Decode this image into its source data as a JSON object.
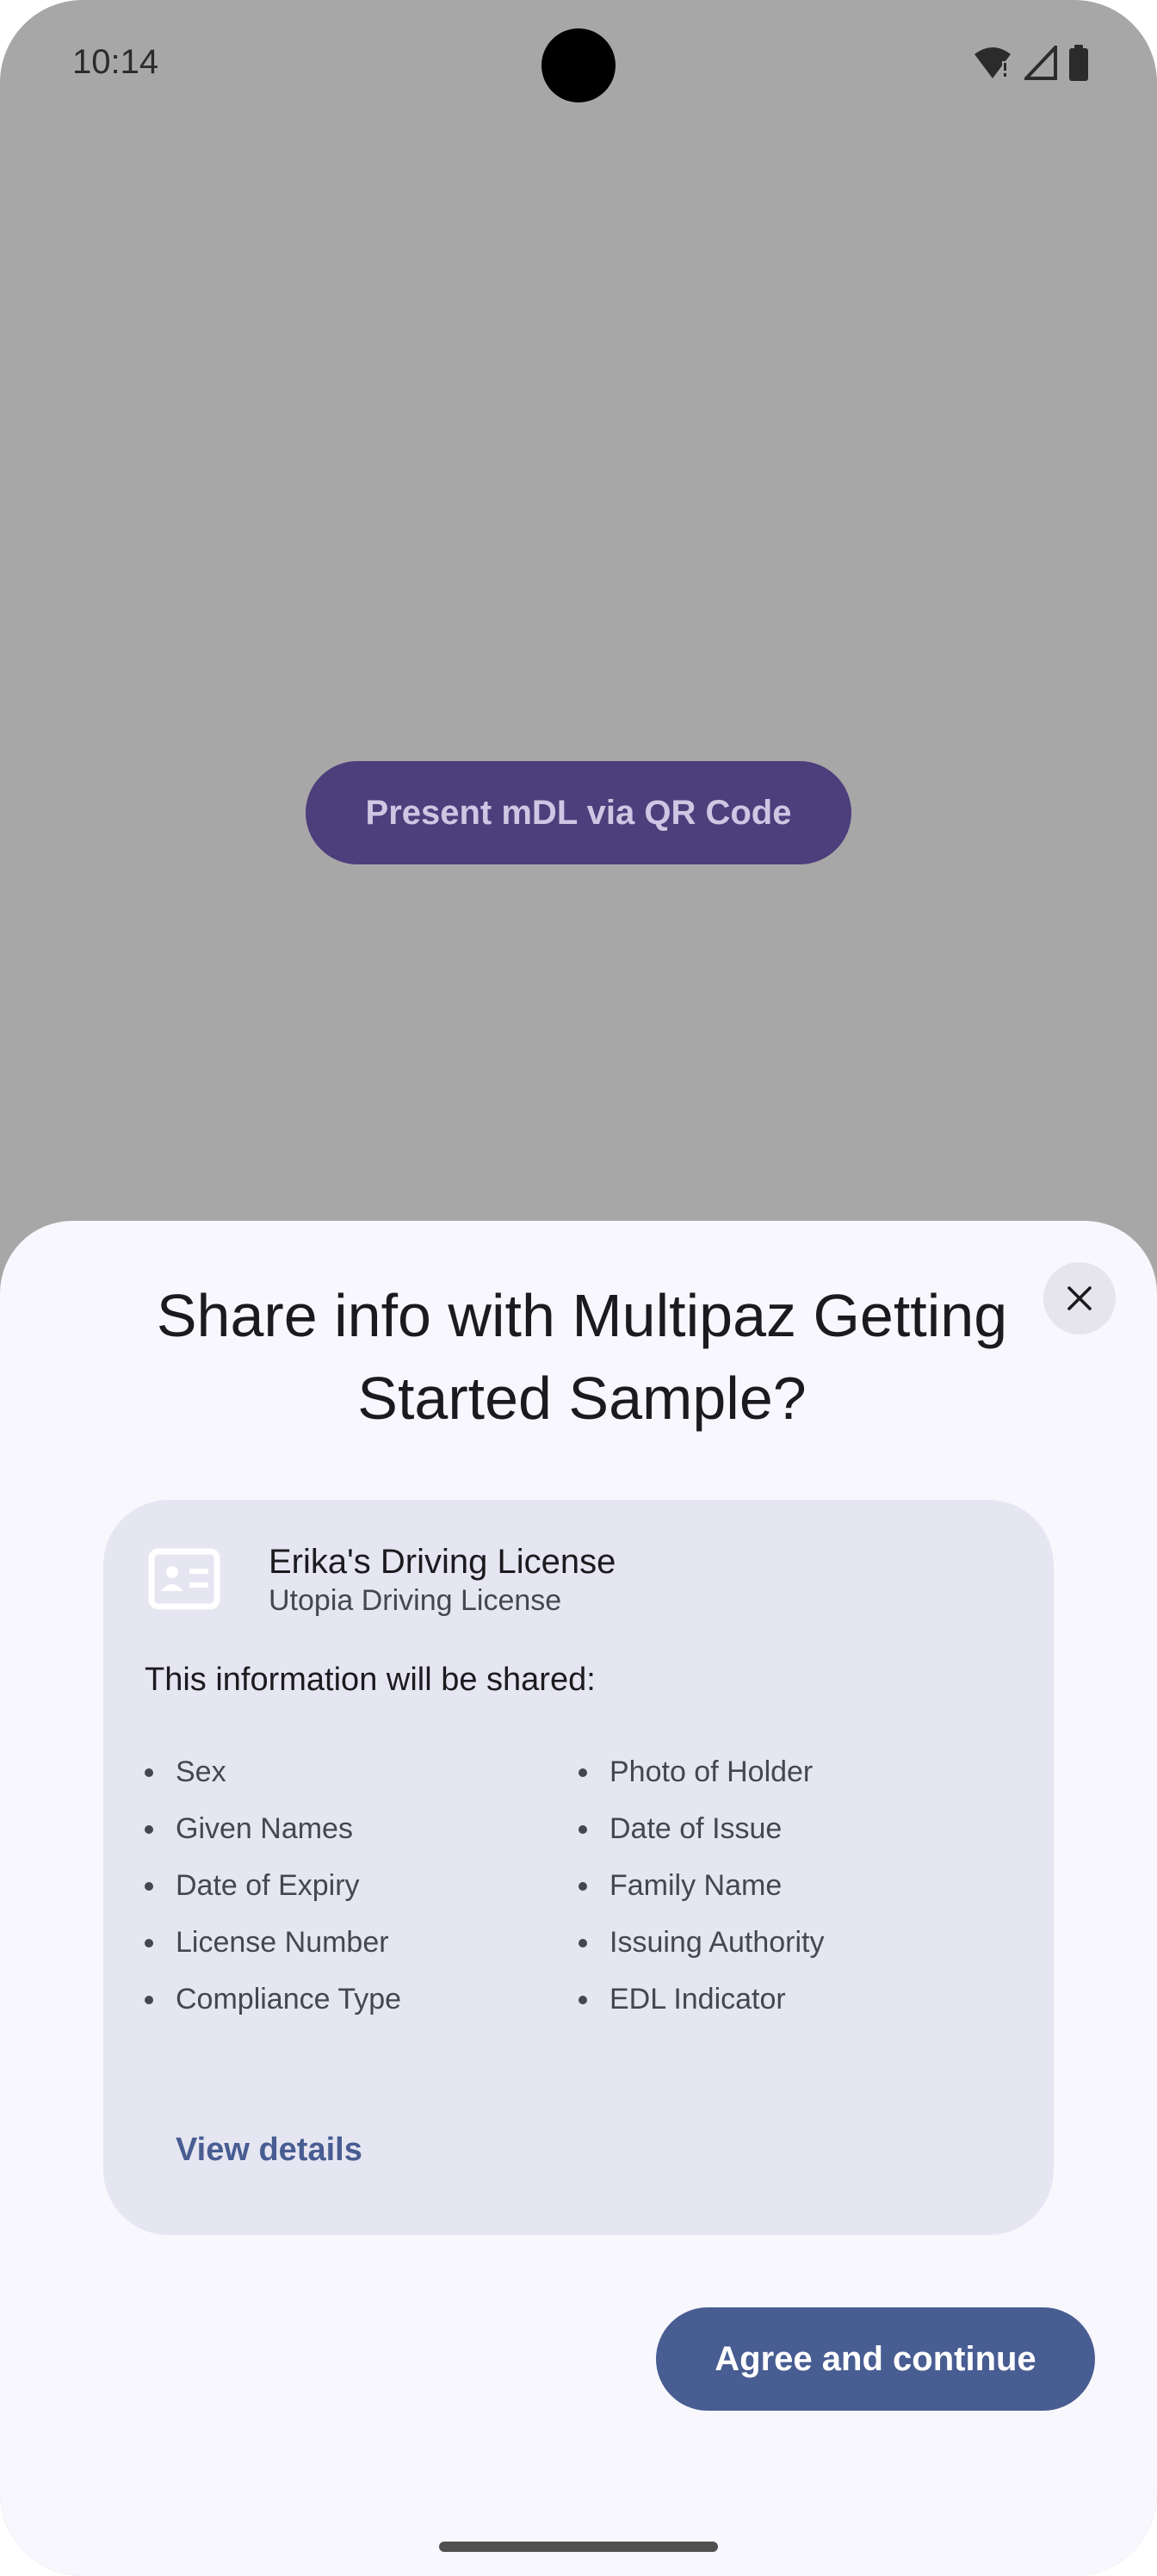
{
  "status_bar": {
    "time": "10:14",
    "icons": [
      "wifi-alert-icon",
      "signal-icon",
      "battery-icon"
    ]
  },
  "background": {
    "present_button_label": "Present mDL via QR Code"
  },
  "sheet": {
    "title": "Share info with Multipaz Getting Started Sample?",
    "close_icon": "close-icon",
    "card": {
      "icon": "id-card-icon",
      "title": "Erika's Driving License",
      "subtitle": "Utopia Driving License",
      "heading": "This information will be shared:",
      "left_items": [
        "Sex",
        "Given Names",
        "Date of Expiry",
        "License Number",
        "Compliance Type"
      ],
      "right_items": [
        "Photo of Holder",
        "Date of Issue",
        "Family Name",
        "Issuing Authority",
        "EDL Indicator"
      ],
      "view_details_label": "View details"
    },
    "agree_label": "Agree and continue"
  },
  "colors": {
    "scrim": "#a7a7a7",
    "present_button": "#4d3e7c",
    "sheet_background": "#f8f7fd",
    "card_background": "#e6e6f2",
    "primary": "#485d92"
  }
}
